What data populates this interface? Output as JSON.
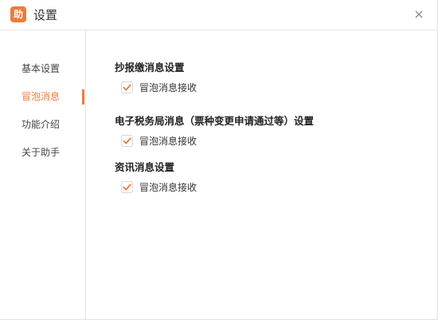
{
  "colors": {
    "accent": "#f07a3a",
    "icon_bg": "#f07a3a",
    "text": "#333333"
  },
  "window": {
    "app_icon_glyph": "助",
    "title": "设置",
    "close_icon": "close-icon"
  },
  "sidebar": {
    "items": [
      {
        "label": "基本设置",
        "active": false
      },
      {
        "label": "冒泡消息",
        "active": true
      },
      {
        "label": "功能介绍",
        "active": false
      },
      {
        "label": "关于助手",
        "active": false
      }
    ]
  },
  "main": {
    "sections": [
      {
        "title": "抄报缴消息设置",
        "option_label": "冒泡消息接收",
        "checked": true
      },
      {
        "title": "电子税务局消息（票种变更申请通过等）设置",
        "option_label": "冒泡消息接收",
        "checked": true
      },
      {
        "title": "资讯消息设置",
        "option_label": "冒泡消息接收",
        "checked": true
      }
    ]
  }
}
